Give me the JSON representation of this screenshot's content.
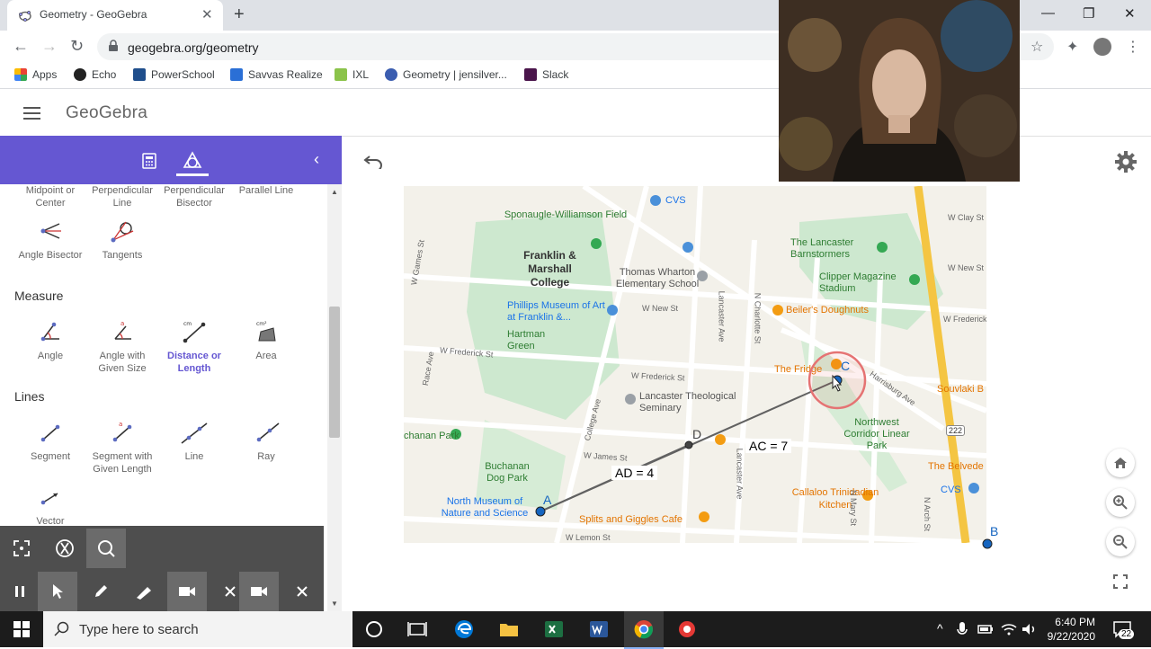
{
  "browser": {
    "tab_title": "Geometry - GeoGebra",
    "url": "geogebra.org/geometry",
    "bookmarks": [
      "Apps",
      "Echo",
      "PowerSchool",
      "Savvas Realize",
      "IXL",
      "Geometry | jensilver...",
      "Slack"
    ]
  },
  "app": {
    "logo": "GeoGebra"
  },
  "sidebar": {
    "tools_row0": [
      "Midpoint or Center",
      "Perpendicular Line",
      "Perpendicular Bisector",
      "Parallel Line"
    ],
    "tools_row1": [
      "Angle Bisector",
      "Tangents"
    ],
    "measure_title": "Measure",
    "measure_tools": [
      "Angle",
      "Angle with Given Size",
      "Distance or Length",
      "Area"
    ],
    "measure_active": "Distance or Length",
    "lines_title": "Lines",
    "lines_tools": [
      "Segment",
      "Segment with Given Length",
      "Line",
      "Ray"
    ],
    "vector_tool": "Vector"
  },
  "construction": {
    "points": [
      "A",
      "B",
      "C",
      "D"
    ],
    "label_ad": "AD = 4",
    "label_ac": "AC = 7"
  },
  "map_labels": {
    "cvs_top": "CVS",
    "sponaugle": "Sponaugle-Williamson Field",
    "franklin": "Franklin & Marshall College",
    "wharton": "Thomas Wharton Elementary School",
    "lancaster_barn": "The Lancaster Barnstormers",
    "clipper": "Clipper Magazine Stadium",
    "beilers": "Beiler's Doughnuts",
    "phillips": "Phillips Museum of Art at Franklin &...",
    "hartman": "Hartman Green",
    "fridge": "The Fridge",
    "lts": "Lancaster Theological Seminary",
    "northwest": "Northwest Corridor Linear Park",
    "souvlaki": "Souvlaki B",
    "belvedere": "The Belvede",
    "cvs_bottom": "CVS",
    "callaloo": "Callaloo Trinidadian Kitchen",
    "buchanan": "Buchanan Dog Park",
    "buchanan_park": "chanan Park",
    "north_museum": "North Museum of Nature and Science",
    "splits": "Splits and Giggles Cafe",
    "w_james": "W James St",
    "w_frederick": "W Frederick St",
    "w_frederick2": "W Frederick St",
    "w_new": "W New St",
    "w_lemon": "W Lemon St",
    "w_clay": "W Clay St",
    "w_new_e": "W New St",
    "w_frederick_e": "W Frederick",
    "college_ave": "College Ave",
    "harrisburg": "Harrisburg Ave",
    "route": "222",
    "lancaster_ave": "Lancaster Ave",
    "lancaster_ave2": "Lancaster Ave",
    "charlotte": "N Charlotte St",
    "mary": "N Mary St",
    "w_games": "W Games St",
    "race": "Race Ave",
    "n_arch": "N Arch St"
  },
  "taskbar": {
    "search_placeholder": "Type here to search",
    "time": "6:40 PM",
    "date": "9/22/2020",
    "notifications": "22"
  }
}
